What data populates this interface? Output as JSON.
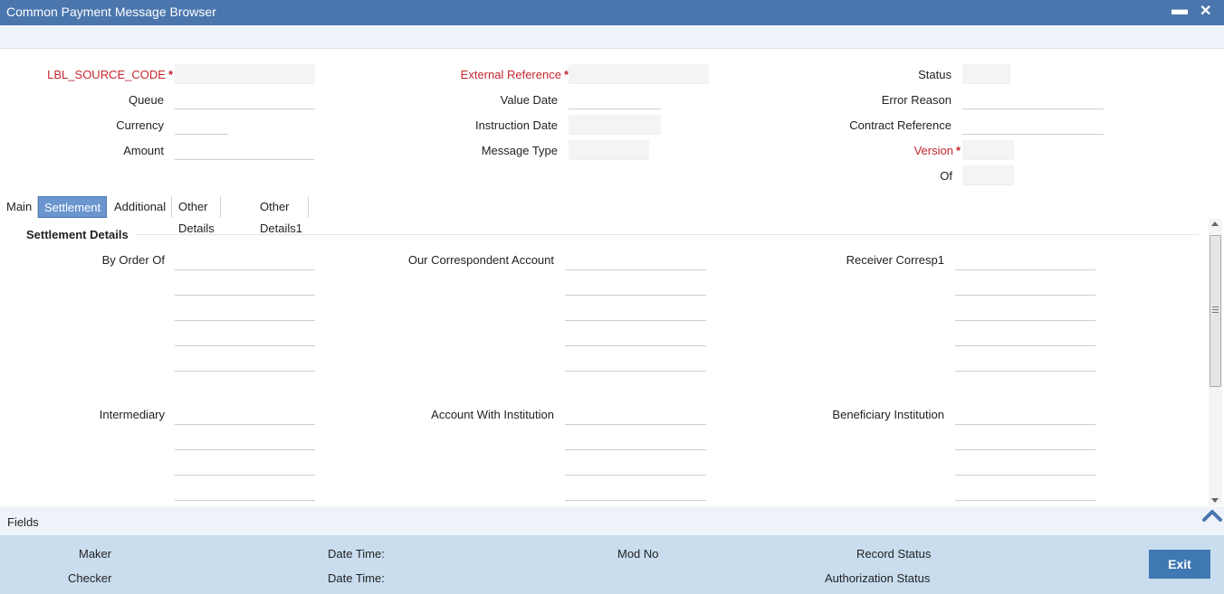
{
  "window": {
    "title": "Common Payment Message Browser",
    "minimize_glyph": "▬",
    "close_glyph": "✕"
  },
  "header_fields": {
    "source_code": {
      "label": "LBL_SOURCE_CODE",
      "required": "*",
      "value": ""
    },
    "queue": {
      "label": "Queue",
      "value": ""
    },
    "currency": {
      "label": "Currency",
      "value": ""
    },
    "amount": {
      "label": "Amount",
      "value": ""
    },
    "external_reference": {
      "label": "External Reference",
      "required": "*",
      "value": ""
    },
    "value_date": {
      "label": "Value Date",
      "value": ""
    },
    "instruction_date": {
      "label": "Instruction Date",
      "value": ""
    },
    "message_type": {
      "label": "Message Type",
      "value": ""
    },
    "status": {
      "label": "Status",
      "value": ""
    },
    "error_reason": {
      "label": "Error Reason",
      "value": ""
    },
    "contract_reference": {
      "label": "Contract Reference",
      "value": ""
    },
    "version": {
      "label": "Version",
      "required": "*",
      "value": ""
    },
    "of": {
      "label": "Of",
      "value": ""
    }
  },
  "tabs": [
    {
      "label": "Main"
    },
    {
      "label": "Settlement"
    },
    {
      "label": "Additional"
    },
    {
      "label": "Other Details"
    },
    {
      "label": "Other Details1"
    }
  ],
  "settlement": {
    "section_title": "Settlement Details",
    "by_order_of": "By Order Of",
    "our_correspondent_account": "Our Correspondent Account",
    "receiver_corresp1": "Receiver Corresp1",
    "intermediary": "Intermediary",
    "account_with_institution": "Account With Institution",
    "beneficiary_institution": "Beneficiary Institution"
  },
  "fields_bar": {
    "label": "Fields"
  },
  "footer": {
    "maker": "Maker",
    "checker": "Checker",
    "date_time_1": "Date Time:",
    "date_time_2": "Date Time:",
    "mod_no": "Mod No",
    "record_status": "Record Status",
    "authorization_status": "Authorization Status",
    "exit_label": "Exit"
  },
  "colors": {
    "titlebar": "#4a76ad",
    "required_label": "#c4262e",
    "active_tab": "#6a95cf",
    "footer": "#c9ddef",
    "exit_button": "#3f78b3"
  }
}
